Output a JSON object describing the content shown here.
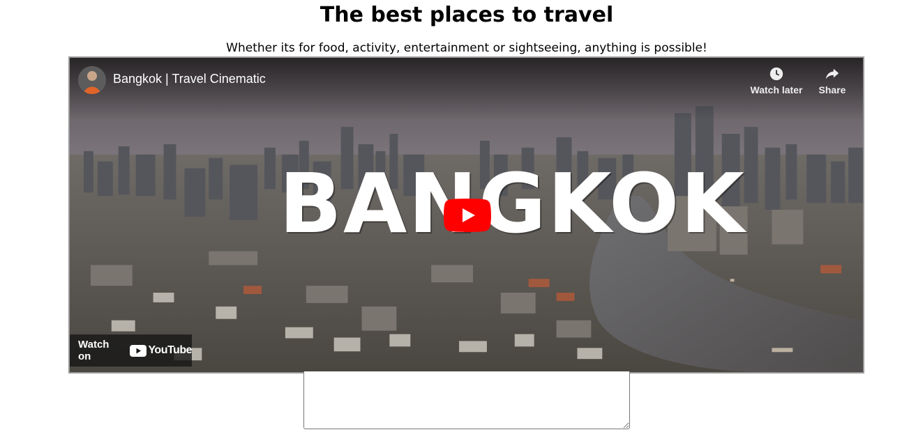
{
  "page": {
    "title": "The best places to travel",
    "subtitle": "Whether its for food, activity, entertainment or sightseeing, anything is possible!"
  },
  "video": {
    "title": "Bangkok | Travel Cinematic",
    "overlay_word": "BANGKOK",
    "watch_later_label": "Watch later",
    "share_label": "Share",
    "watch_on_label": "Watch on",
    "youtube_label": "YouTube",
    "icons": {
      "watch_later": "clock-icon",
      "share": "share-arrow-icon",
      "play": "play-button-icon",
      "youtube": "youtube-logo-icon"
    },
    "colors": {
      "play_red": "#ff0000",
      "overlay_text": "#ffffff"
    }
  },
  "textarea": {
    "value": "",
    "placeholder": ""
  }
}
